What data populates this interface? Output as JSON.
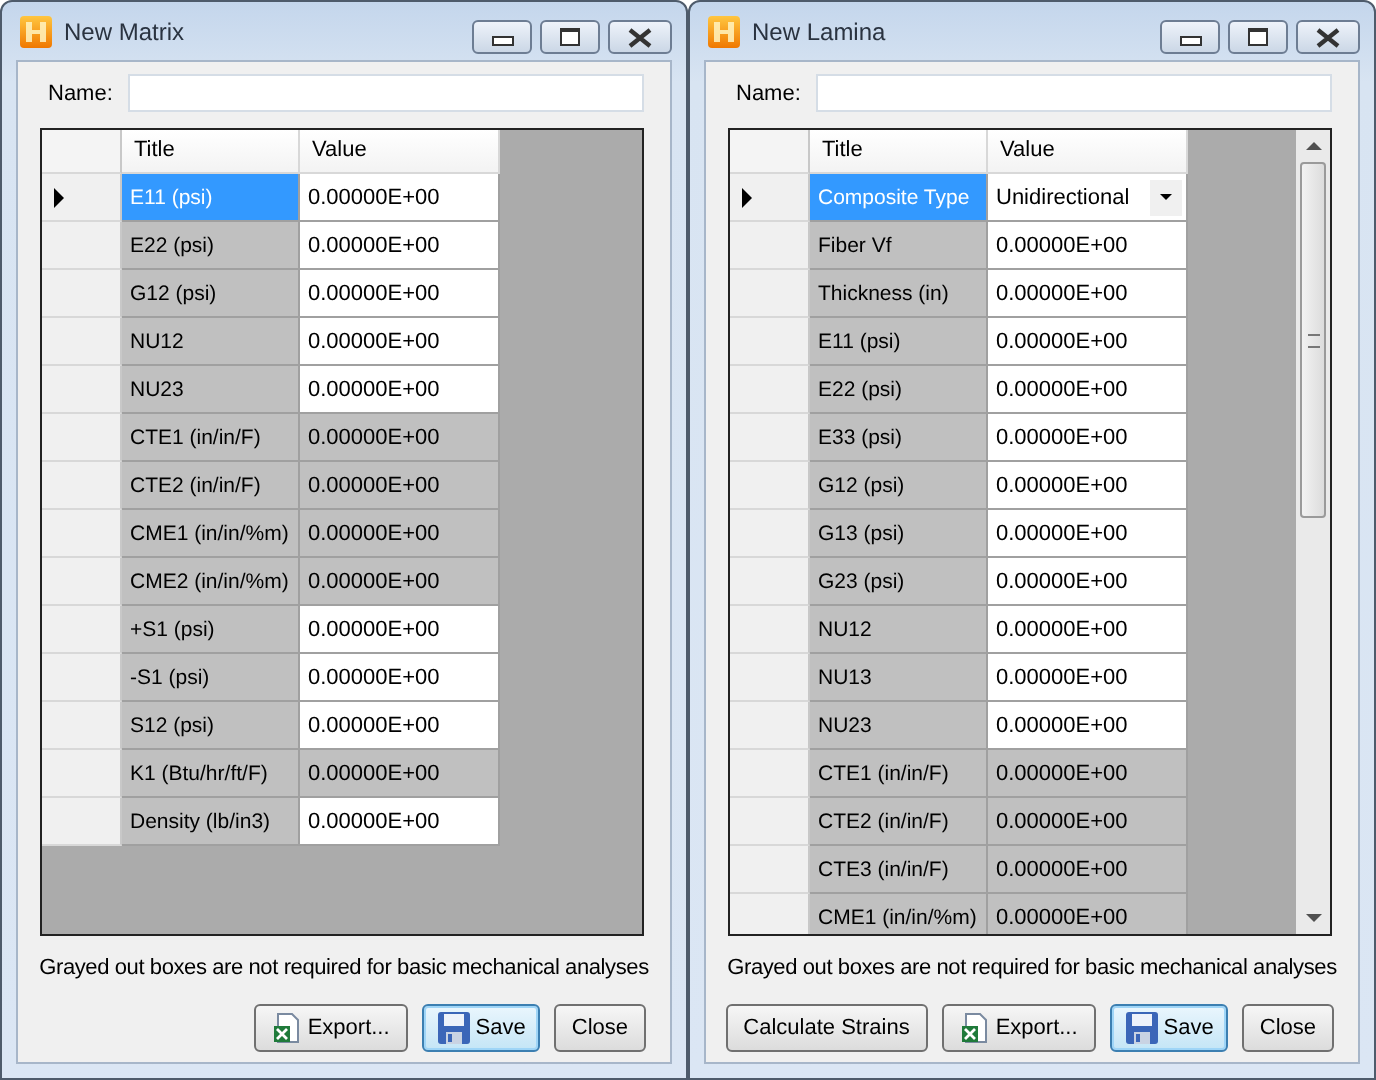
{
  "windows": [
    {
      "title": "New Matrix",
      "name_label": "Name:",
      "grid": {
        "columns": [
          "Title",
          "Value"
        ],
        "scrollbar": false,
        "rows": [
          {
            "title": "E11 (psi)",
            "value": "0.00000E+00",
            "grayed": false,
            "selected": true
          },
          {
            "title": "E22 (psi)",
            "value": "0.00000E+00",
            "grayed": false,
            "selected": false
          },
          {
            "title": "G12 (psi)",
            "value": "0.00000E+00",
            "grayed": false,
            "selected": false
          },
          {
            "title": "NU12",
            "value": "0.00000E+00",
            "grayed": false,
            "selected": false
          },
          {
            "title": "NU23",
            "value": "0.00000E+00",
            "grayed": false,
            "selected": false
          },
          {
            "title": "CTE1 (in/in/F)",
            "value": "0.00000E+00",
            "grayed": true,
            "selected": false
          },
          {
            "title": "CTE2 (in/in/F)",
            "value": "0.00000E+00",
            "grayed": true,
            "selected": false
          },
          {
            "title": "CME1 (in/in/%m)",
            "value": "0.00000E+00",
            "grayed": true,
            "selected": false
          },
          {
            "title": "CME2 (in/in/%m)",
            "value": "0.00000E+00",
            "grayed": true,
            "selected": false
          },
          {
            "title": "+S1 (psi)",
            "value": "0.00000E+00",
            "grayed": false,
            "selected": false
          },
          {
            "title": "-S1 (psi)",
            "value": "0.00000E+00",
            "grayed": false,
            "selected": false
          },
          {
            "title": "S12 (psi)",
            "value": "0.00000E+00",
            "grayed": false,
            "selected": false
          },
          {
            "title": "K1 (Btu/hr/ft/F)",
            "value": "0.00000E+00",
            "grayed": true,
            "selected": false
          },
          {
            "title": "Density (lb/in3)",
            "value": "0.00000E+00",
            "grayed": false,
            "selected": false
          }
        ]
      },
      "note": "Grayed out boxes are not required for basic mechanical analyses",
      "buttons": [
        {
          "label": "Export...",
          "kind": "export",
          "default": false
        },
        {
          "label": "Save",
          "kind": "save",
          "default": true
        },
        {
          "label": "Close",
          "kind": "plain",
          "default": false
        }
      ]
    },
    {
      "title": "New Lamina",
      "name_label": "Name:",
      "grid": {
        "columns": [
          "Title",
          "Value"
        ],
        "scrollbar": true,
        "rows": [
          {
            "title": "Composite Type",
            "value": "Unidirectional",
            "grayed": false,
            "selected": true,
            "kind": "dropdown"
          },
          {
            "title": "Fiber Vf",
            "value": "0.00000E+00",
            "grayed": false,
            "selected": false,
            "kind": "text"
          },
          {
            "title": "Thickness (in)",
            "value": "0.00000E+00",
            "grayed": false,
            "selected": false,
            "kind": "text"
          },
          {
            "title": "E11 (psi)",
            "value": "0.00000E+00",
            "grayed": false,
            "selected": false,
            "kind": "text"
          },
          {
            "title": "E22 (psi)",
            "value": "0.00000E+00",
            "grayed": false,
            "selected": false,
            "kind": "text"
          },
          {
            "title": "E33 (psi)",
            "value": "0.00000E+00",
            "grayed": false,
            "selected": false,
            "kind": "text"
          },
          {
            "title": "G12 (psi)",
            "value": "0.00000E+00",
            "grayed": false,
            "selected": false,
            "kind": "text"
          },
          {
            "title": "G13 (psi)",
            "value": "0.00000E+00",
            "grayed": false,
            "selected": false,
            "kind": "text"
          },
          {
            "title": "G23 (psi)",
            "value": "0.00000E+00",
            "grayed": false,
            "selected": false,
            "kind": "text"
          },
          {
            "title": "NU12",
            "value": "0.00000E+00",
            "grayed": false,
            "selected": false,
            "kind": "text"
          },
          {
            "title": "NU13",
            "value": "0.00000E+00",
            "grayed": false,
            "selected": false,
            "kind": "text"
          },
          {
            "title": "NU23",
            "value": "0.00000E+00",
            "grayed": false,
            "selected": false,
            "kind": "text"
          },
          {
            "title": "CTE1 (in/in/F)",
            "value": "0.00000E+00",
            "grayed": true,
            "selected": false,
            "kind": "text"
          },
          {
            "title": "CTE2 (in/in/F)",
            "value": "0.00000E+00",
            "grayed": true,
            "selected": false,
            "kind": "text"
          },
          {
            "title": "CTE3 (in/in/F)",
            "value": "0.00000E+00",
            "grayed": true,
            "selected": false,
            "kind": "text"
          },
          {
            "title": "CME1 (in/in/%m)",
            "value": "0.00000E+00",
            "grayed": true,
            "selected": false,
            "kind": "text"
          }
        ]
      },
      "note": "Grayed out boxes are not required for basic mechanical analyses",
      "buttons": [
        {
          "label": "Calculate Strains",
          "kind": "plain",
          "default": false
        },
        {
          "label": "Export...",
          "kind": "export",
          "default": false
        },
        {
          "label": "Save",
          "kind": "save",
          "default": true
        },
        {
          "label": "Close",
          "kind": "plain",
          "default": false
        }
      ]
    }
  ]
}
